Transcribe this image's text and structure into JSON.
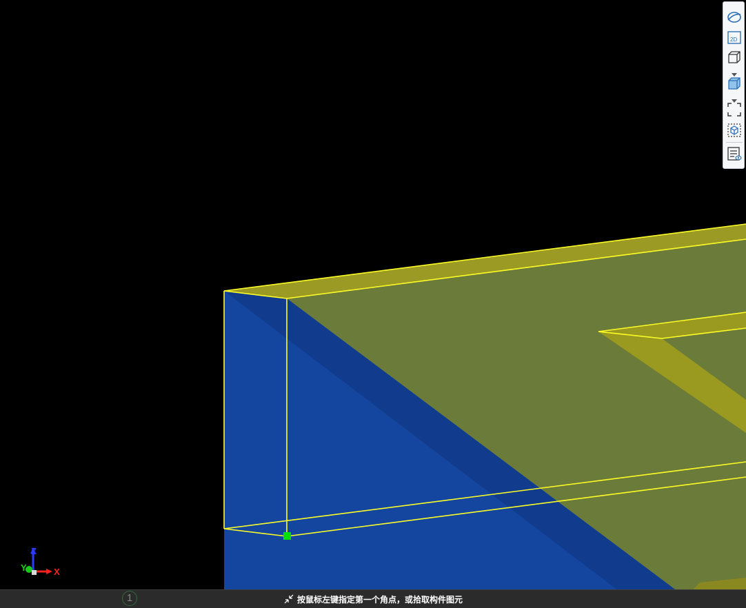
{
  "toolbar": {
    "buttons": [
      {
        "name": "dynamic-observe",
        "icon": "orbit-icon"
      },
      {
        "name": "2d-view",
        "icon": "2d-view-icon",
        "label": "2D"
      },
      {
        "name": "3d-view",
        "icon": "3d-wireframe-box-icon",
        "has_dropdown": true
      },
      {
        "name": "display-mode",
        "icon": "shaded-box-icon",
        "has_dropdown": true
      },
      {
        "name": "full-screen",
        "icon": "fullscreen-icon"
      },
      {
        "name": "local-3d",
        "icon": "local-3d-icon"
      },
      {
        "name": "display-settings",
        "icon": "display-settings-icon"
      }
    ]
  },
  "axes": {
    "z": "Z",
    "y": "Y",
    "x": "X"
  },
  "colors": {
    "background": "#000000",
    "blue_face": "#1446a0",
    "olive_face": "#6b7b3a",
    "yellow_edge": "#ffff26",
    "mustard_band": "#989a20",
    "selected_point": "#00e000"
  },
  "status": {
    "message": "按鼠标左键指定第一个角点，或拾取构件图元",
    "viewport_number": "1"
  }
}
